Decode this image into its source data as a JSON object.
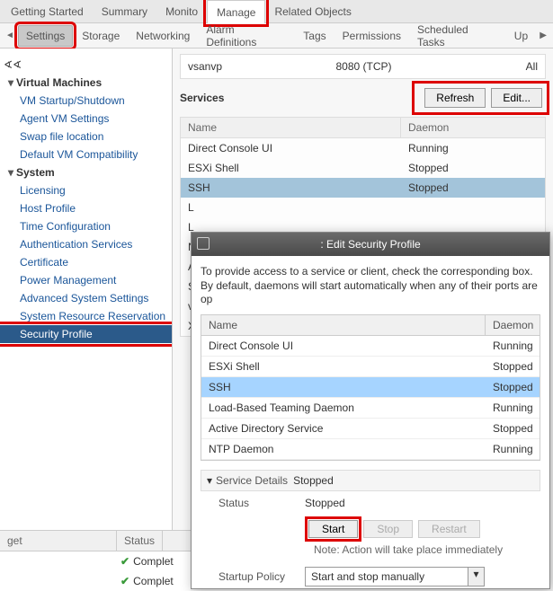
{
  "topTabs": {
    "t0": "Getting Started",
    "t1": "Summary",
    "t2": "Monito",
    "t3": "Manage",
    "t4": "Related Objects"
  },
  "subTabs": {
    "s0": "Settings",
    "s1": "Storage",
    "s2": "Networking",
    "s3": "Alarm Definitions",
    "s4": "Tags",
    "s5": "Permissions",
    "s6": "Scheduled Tasks",
    "s7": "Up"
  },
  "sidebar": {
    "vm": "Virtual Machines",
    "vm0": "VM Startup/Shutdown",
    "vm1": "Agent VM Settings",
    "vm2": "Swap file location",
    "vm3": "Default VM Compatibility",
    "sys": "System",
    "sys0": "Licensing",
    "sys1": "Host Profile",
    "sys2": "Time Configuration",
    "sys3": "Authentication Services",
    "sys4": "Certificate",
    "sys5": "Power Management",
    "sys6": "Advanced System Settings",
    "sys7": "System Resource Reservation",
    "sys8": "Security Profile"
  },
  "firewallRow": {
    "name": "vsanvp",
    "port": "8080 (TCP)",
    "dir": "All"
  },
  "servicesTitle": "Services",
  "refresh": "Refresh",
  "edit": "Edit...",
  "svcHead": {
    "name": "Name",
    "daemon": "Daemon"
  },
  "svc": {
    "r0n": "Direct Console UI",
    "r0d": "Running",
    "r1n": "ESXi Shell",
    "r1d": "Stopped",
    "r2n": "SSH",
    "r2d": "Stopped",
    "r3n": "L",
    "r4n": "L",
    "r5n": "N",
    "r6n": "A",
    "r7n": "S",
    "r8n": "v",
    "r9n": "X"
  },
  "dialog": {
    "title": ": Edit Security Profile",
    "desc1": "To provide access to a service or client, check the corresponding box.",
    "desc2": "By default, daemons will start automatically when any of their ports are op",
    "head": {
      "name": "Name",
      "daemon": "Daemon"
    },
    "rows": {
      "r0n": "Direct Console UI",
      "r0d": "Running",
      "r1n": "ESXi Shell",
      "r1d": "Stopped",
      "r2n": "SSH",
      "r2d": "Stopped",
      "r3n": "Load-Based Teaming Daemon",
      "r3d": "Running",
      "r4n": "Active Directory Service",
      "r4d": "Stopped",
      "r5n": "NTP Daemon",
      "r5d": "Running"
    },
    "detailsHeader": "Service Details",
    "detailsValue": "Stopped",
    "statusLbl": "Status",
    "statusVal": "Stopped",
    "start": "Start",
    "stop": "Stop",
    "restart": "Restart",
    "note": "Note: Action will take place immediately",
    "policyLbl": "Startup Policy",
    "policyVal": "Start and stop manually"
  },
  "tasks": {
    "h0": "get",
    "h1": "Status",
    "complete": "Complet"
  }
}
